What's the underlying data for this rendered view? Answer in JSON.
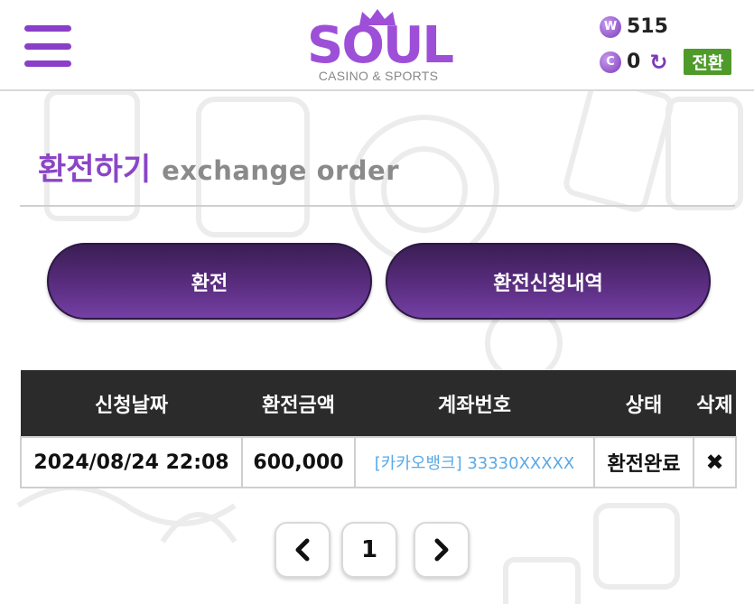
{
  "logo": {
    "word": "SOUL",
    "subtitle": "CASINO & SPORTS"
  },
  "balance": {
    "w_icon": "W",
    "w_amount": "515",
    "c_icon": "C",
    "c_amount": "0",
    "refresh_icon": "↻",
    "convert_label": "전환"
  },
  "title": {
    "korean": "환전하기",
    "english": "exchange order"
  },
  "tabs": [
    {
      "label": "환전"
    },
    {
      "label": "환전신청내역"
    }
  ],
  "table": {
    "headers": [
      "신청날짜",
      "환전금액",
      "계좌번호",
      "상태",
      "삭제"
    ],
    "rows": [
      {
        "date": "2024/08/24 22:08",
        "amount": "600,000",
        "account": "[카카오뱅크] 33330XXXXX",
        "status": "환전완료",
        "delete": "✖"
      }
    ]
  },
  "pagination": {
    "prev": "‹",
    "current": "1",
    "next": "›"
  },
  "colors": {
    "accent": "#8b45c6",
    "convert": "#4e9a2a",
    "header_bg": "#2b2b2b",
    "account_text": "#5aa9e6"
  }
}
